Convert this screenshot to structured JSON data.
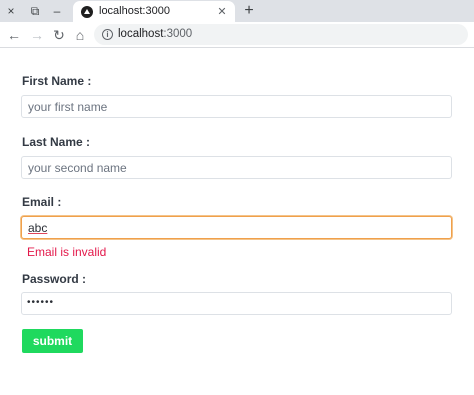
{
  "browser": {
    "tab": {
      "title": "localhost:3000",
      "favicon": "nextjs-triangle-icon"
    },
    "window_controls": {
      "close": "×",
      "restore": "⧉",
      "minimize": "–"
    },
    "new_tab_glyph": "+",
    "nav": {
      "back": "←",
      "forward": "→",
      "reload": "↻",
      "home": "⌂"
    },
    "address": {
      "host": "localhost",
      "port": ":3000",
      "info": "i"
    }
  },
  "form": {
    "first_name": {
      "label": "First Name :",
      "placeholder": "your first name",
      "value": ""
    },
    "last_name": {
      "label": "Last Name :",
      "placeholder": "your second name",
      "value": ""
    },
    "email": {
      "label": "Email :",
      "value": "abc",
      "error": "Email is invalid",
      "state": "invalid"
    },
    "password": {
      "label": "Password :",
      "masked_value": "••••••"
    },
    "submit_label": "submit"
  },
  "colors": {
    "submit_bg": "#1fd95e",
    "error_text": "#e3184a",
    "invalid_border": "#f0a04b",
    "label_text": "#333a44"
  }
}
